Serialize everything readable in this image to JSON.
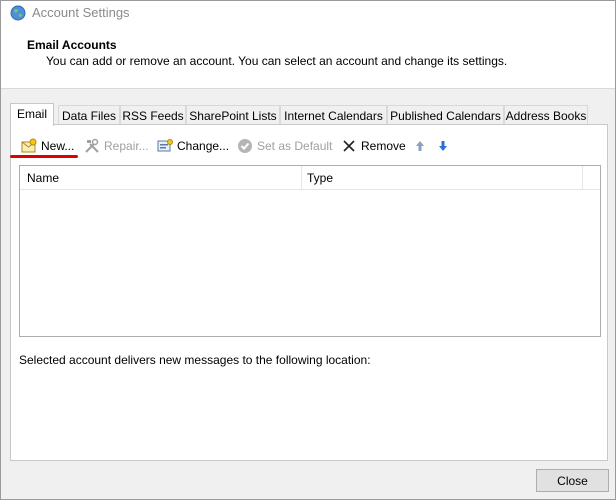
{
  "window": {
    "title": "Account Settings"
  },
  "header": {
    "title": "Email Accounts",
    "subtitle": "You can add or remove an account. You can select an account and change its settings."
  },
  "tabs": [
    {
      "label": "Email",
      "active": true
    },
    {
      "label": "Data Files"
    },
    {
      "label": "RSS Feeds"
    },
    {
      "label": "SharePoint Lists"
    },
    {
      "label": "Internet Calendars"
    },
    {
      "label": "Published Calendars"
    },
    {
      "label": "Address Books"
    }
  ],
  "toolbar": {
    "new_label": "New...",
    "repair_label": "Repair...",
    "change_label": "Change...",
    "set_default_label": "Set as Default",
    "remove_label": "Remove"
  },
  "list": {
    "col_name": "Name",
    "col_type": "Type"
  },
  "deliver_text": "Selected account delivers new messages to the following location:",
  "footer": {
    "close_label": "Close"
  },
  "colors": {
    "annotation": "#e00000",
    "arrow_up": "#8aa0c0",
    "arrow_down": "#2e6fd6"
  }
}
